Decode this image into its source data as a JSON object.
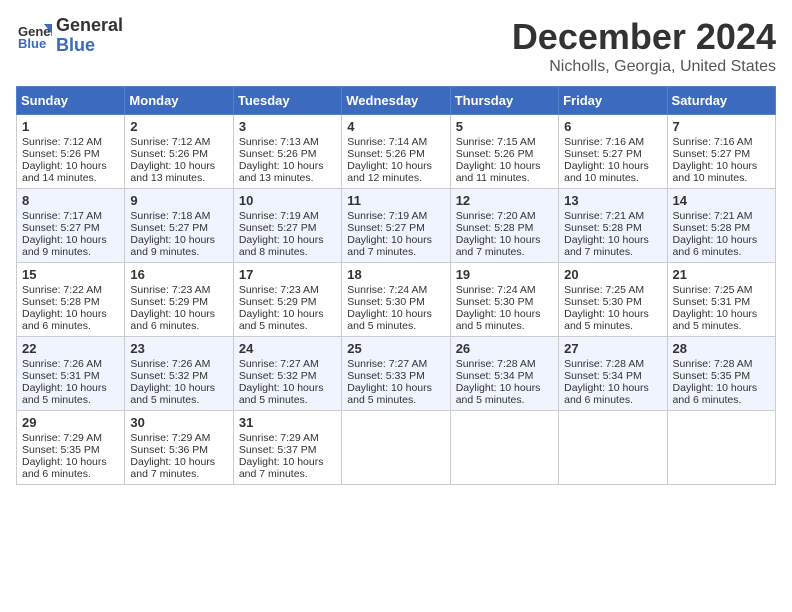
{
  "logo": {
    "line1": "General",
    "line2": "Blue"
  },
  "title": "December 2024",
  "subtitle": "Nicholls, Georgia, United States",
  "weekdays": [
    "Sunday",
    "Monday",
    "Tuesday",
    "Wednesday",
    "Thursday",
    "Friday",
    "Saturday"
  ],
  "weeks": [
    [
      {
        "day": "1",
        "sunrise": "7:12 AM",
        "sunset": "5:26 PM",
        "daylight": "10 hours and 14 minutes."
      },
      {
        "day": "2",
        "sunrise": "7:12 AM",
        "sunset": "5:26 PM",
        "daylight": "10 hours and 13 minutes."
      },
      {
        "day": "3",
        "sunrise": "7:13 AM",
        "sunset": "5:26 PM",
        "daylight": "10 hours and 13 minutes."
      },
      {
        "day": "4",
        "sunrise": "7:14 AM",
        "sunset": "5:26 PM",
        "daylight": "10 hours and 12 minutes."
      },
      {
        "day": "5",
        "sunrise": "7:15 AM",
        "sunset": "5:26 PM",
        "daylight": "10 hours and 11 minutes."
      },
      {
        "day": "6",
        "sunrise": "7:16 AM",
        "sunset": "5:27 PM",
        "daylight": "10 hours and 10 minutes."
      },
      {
        "day": "7",
        "sunrise": "7:16 AM",
        "sunset": "5:27 PM",
        "daylight": "10 hours and 10 minutes."
      }
    ],
    [
      {
        "day": "8",
        "sunrise": "7:17 AM",
        "sunset": "5:27 PM",
        "daylight": "10 hours and 9 minutes."
      },
      {
        "day": "9",
        "sunrise": "7:18 AM",
        "sunset": "5:27 PM",
        "daylight": "10 hours and 9 minutes."
      },
      {
        "day": "10",
        "sunrise": "7:19 AM",
        "sunset": "5:27 PM",
        "daylight": "10 hours and 8 minutes."
      },
      {
        "day": "11",
        "sunrise": "7:19 AM",
        "sunset": "5:27 PM",
        "daylight": "10 hours and 7 minutes."
      },
      {
        "day": "12",
        "sunrise": "7:20 AM",
        "sunset": "5:28 PM",
        "daylight": "10 hours and 7 minutes."
      },
      {
        "day": "13",
        "sunrise": "7:21 AM",
        "sunset": "5:28 PM",
        "daylight": "10 hours and 7 minutes."
      },
      {
        "day": "14",
        "sunrise": "7:21 AM",
        "sunset": "5:28 PM",
        "daylight": "10 hours and 6 minutes."
      }
    ],
    [
      {
        "day": "15",
        "sunrise": "7:22 AM",
        "sunset": "5:28 PM",
        "daylight": "10 hours and 6 minutes."
      },
      {
        "day": "16",
        "sunrise": "7:23 AM",
        "sunset": "5:29 PM",
        "daylight": "10 hours and 6 minutes."
      },
      {
        "day": "17",
        "sunrise": "7:23 AM",
        "sunset": "5:29 PM",
        "daylight": "10 hours and 5 minutes."
      },
      {
        "day": "18",
        "sunrise": "7:24 AM",
        "sunset": "5:30 PM",
        "daylight": "10 hours and 5 minutes."
      },
      {
        "day": "19",
        "sunrise": "7:24 AM",
        "sunset": "5:30 PM",
        "daylight": "10 hours and 5 minutes."
      },
      {
        "day": "20",
        "sunrise": "7:25 AM",
        "sunset": "5:30 PM",
        "daylight": "10 hours and 5 minutes."
      },
      {
        "day": "21",
        "sunrise": "7:25 AM",
        "sunset": "5:31 PM",
        "daylight": "10 hours and 5 minutes."
      }
    ],
    [
      {
        "day": "22",
        "sunrise": "7:26 AM",
        "sunset": "5:31 PM",
        "daylight": "10 hours and 5 minutes."
      },
      {
        "day": "23",
        "sunrise": "7:26 AM",
        "sunset": "5:32 PM",
        "daylight": "10 hours and 5 minutes."
      },
      {
        "day": "24",
        "sunrise": "7:27 AM",
        "sunset": "5:32 PM",
        "daylight": "10 hours and 5 minutes."
      },
      {
        "day": "25",
        "sunrise": "7:27 AM",
        "sunset": "5:33 PM",
        "daylight": "10 hours and 5 minutes."
      },
      {
        "day": "26",
        "sunrise": "7:28 AM",
        "sunset": "5:34 PM",
        "daylight": "10 hours and 5 minutes."
      },
      {
        "day": "27",
        "sunrise": "7:28 AM",
        "sunset": "5:34 PM",
        "daylight": "10 hours and 6 minutes."
      },
      {
        "day": "28",
        "sunrise": "7:28 AM",
        "sunset": "5:35 PM",
        "daylight": "10 hours and 6 minutes."
      }
    ],
    [
      {
        "day": "29",
        "sunrise": "7:29 AM",
        "sunset": "5:35 PM",
        "daylight": "10 hours and 6 minutes."
      },
      {
        "day": "30",
        "sunrise": "7:29 AM",
        "sunset": "5:36 PM",
        "daylight": "10 hours and 7 minutes."
      },
      {
        "day": "31",
        "sunrise": "7:29 AM",
        "sunset": "5:37 PM",
        "daylight": "10 hours and 7 minutes."
      },
      null,
      null,
      null,
      null
    ]
  ],
  "labels": {
    "sunrise": "Sunrise:",
    "sunset": "Sunset:",
    "daylight": "Daylight:"
  }
}
